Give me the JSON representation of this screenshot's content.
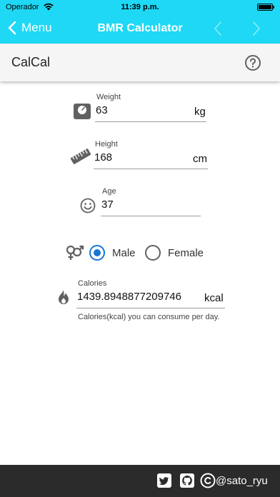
{
  "status": {
    "carrier": "Operador",
    "time": "11:39 p.m."
  },
  "nav": {
    "back_label": "Menu",
    "title": "BMR Calculator"
  },
  "header": {
    "app_name": "CalCal"
  },
  "weight": {
    "label": "Weight",
    "value": "63",
    "unit": "kg"
  },
  "height": {
    "label": "Height",
    "value": "168",
    "unit": "cm"
  },
  "age": {
    "label": "Age",
    "value": "37"
  },
  "gender": {
    "options": [
      {
        "label": "Male",
        "selected": true
      },
      {
        "label": "Female",
        "selected": false
      }
    ]
  },
  "calories": {
    "label": "Calories",
    "value": "1439.8948877209746",
    "unit": "kcal",
    "hint": "Calories(kcal) you can consume per day."
  },
  "footer": {
    "handle": "@sato_ryu",
    "icons": [
      "twitter-icon",
      "github-icon",
      "copyright-icon"
    ]
  },
  "colors": {
    "accent": "#1ed8f5",
    "radio_selected": "#1976d2",
    "footer_bg": "#2b2b2b",
    "header_bg": "#f5f5f5"
  }
}
